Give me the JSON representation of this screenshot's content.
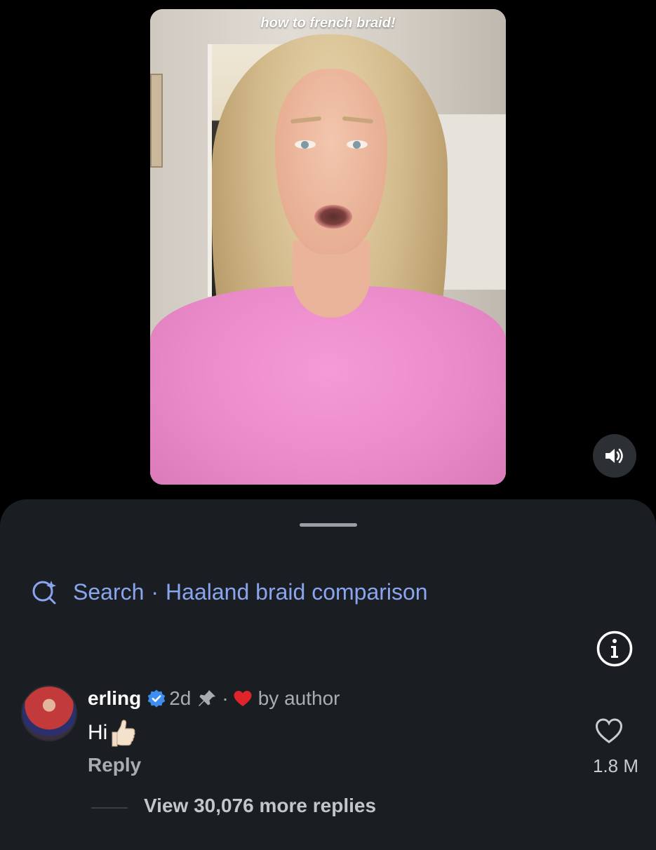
{
  "video": {
    "caption": "how to french braid!"
  },
  "comments": {
    "search": {
      "prefix": "Search",
      "separator": "·",
      "query": "Haaland braid comparison"
    },
    "items": [
      {
        "username": "erling",
        "verified": true,
        "time": "2d",
        "pinned": true,
        "liked_by_author_label": "by author",
        "text": "Hi",
        "emoji": "thumbs-up",
        "reply_label": "Reply",
        "like_count": "1.8 M",
        "view_more_replies": "View 30,076 more replies"
      }
    ]
  },
  "colors": {
    "background": "#000000",
    "sheet": "#1a1d21",
    "search_accent": "#8aa5ef",
    "verified_blue": "#3d8ef0",
    "heart_red": "#e0242c"
  }
}
